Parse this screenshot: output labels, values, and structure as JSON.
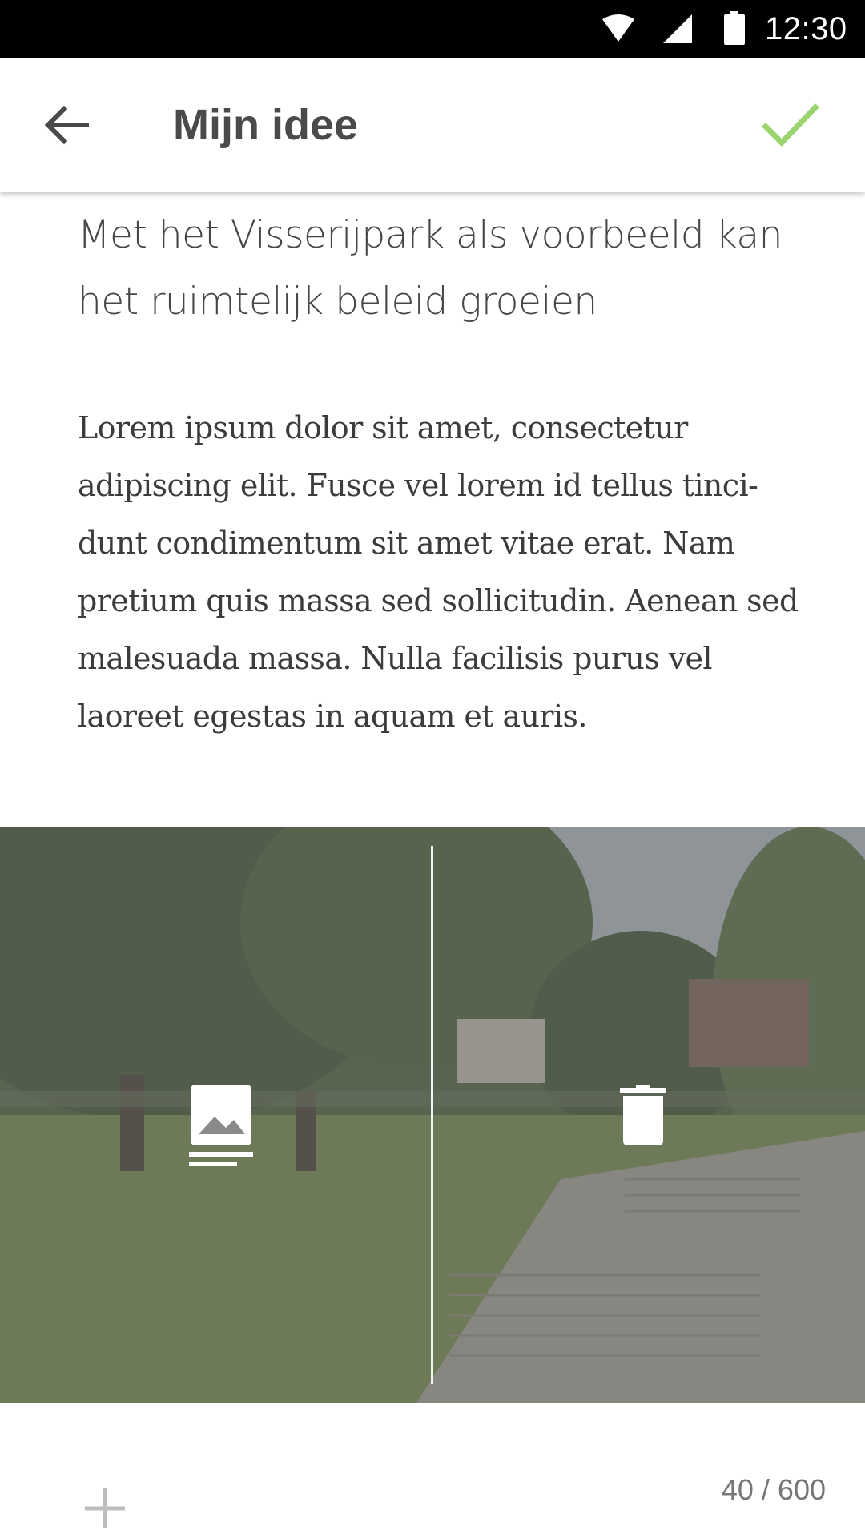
{
  "status_bar": {
    "time": "12:30",
    "icons": [
      "wifi-icon",
      "signal-icon",
      "battery-icon"
    ]
  },
  "app_bar": {
    "title": "Mijn idee",
    "back_icon": "arrow-left-icon",
    "confirm_icon": "check-icon",
    "confirm_color": "#9bd46e"
  },
  "content": {
    "headline": "Met het Visserijpark als voorbeeld kan het ruimtelijk beleid groeien",
    "body": "Lorem ipsum dolor sit amet, consectetur adipiscing elit. Fusce vel lorem id tellus tinci-dunt condimentum sit amet vitae erat. Nam pretium quis massa sed sollicitudin. Aenean sed malesuada massa. Nulla facilisis purus vel laoreet egestas in aquam et auris."
  },
  "photo": {
    "actions": [
      {
        "icon": "image-change-icon"
      },
      {
        "icon": "trash-icon"
      }
    ]
  },
  "footer": {
    "add_icon": "plus-icon",
    "counter": "40 / 600"
  }
}
